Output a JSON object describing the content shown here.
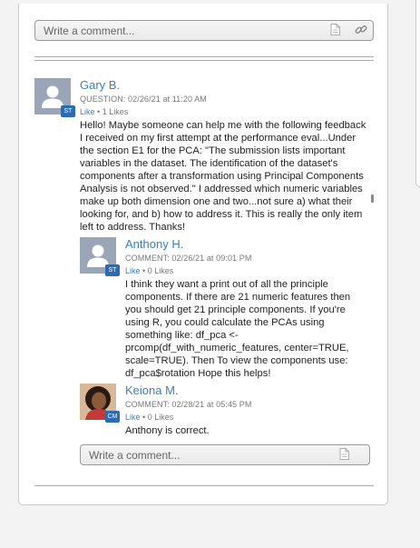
{
  "comment_box": {
    "placeholder": "Write a comment..."
  },
  "post": {
    "author": "Gary B.",
    "badge": "ST",
    "meta": "QUESTION: 02/26/21 at 11:20 AM",
    "like_label": "Like",
    "likes_count": "1 Likes",
    "body": "Hello! Maybe someone can help me with the following feedback I received on my first attempt at the performance eval...Under the section E1 for the PCA: \"The submission lists important variables in the dataset. The identification of the dataset's components after a transformation using Principal Components Analysis is not observed.\" I addressed which numeric variables make up both dimension one and two...not sure a) what their looking for, and b) how to address it. This is really the only item left to address. Thanks!"
  },
  "replies": [
    {
      "author": "Anthony H.",
      "badge": "ST",
      "meta": "COMMENT: 02/26/21 at 09:01 PM",
      "like_label": "Like",
      "likes_count": "0 Likes",
      "body": "I think they want a print out of all the principle components. If there are 21 numeric features then you should get 21 principle components. If you're using R, you could calculate the PCAs using something like: df_pca <- prcomp(df_with_numeric_features, center=TRUE, scale=TRUE). Then To view the components use: df_pca$rotation Hope this helps!"
    },
    {
      "author": "Keiona M.",
      "badge": "CM",
      "meta": "COMMENT: 02/28/21 at 05:45 PM",
      "like_label": "Like",
      "likes_count": "0 Likes",
      "body": "Anthony is correct."
    }
  ],
  "icons": {
    "attach": "document-icon",
    "link": "link-icon",
    "avatar_default": "user-silhouette-icon"
  },
  "colors": {
    "accent": "#3a7fc1",
    "badge": "#2b6cb0",
    "avatar_bg": "#9aa6b8"
  }
}
